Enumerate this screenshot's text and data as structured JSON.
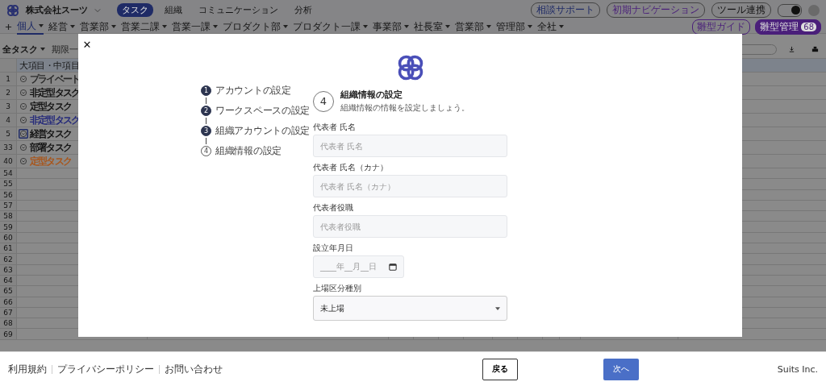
{
  "header": {
    "company": "株式会社スーツ",
    "nav": [
      {
        "label": "タスク",
        "selected": true
      },
      {
        "label": "組織",
        "selected": false
      },
      {
        "label": "コミュニケーション",
        "selected": false
      },
      {
        "label": "分析",
        "selected": false
      }
    ],
    "actions": [
      {
        "label": "相談サポート",
        "kind": "blue"
      },
      {
        "label": "初期ナビゲーション",
        "kind": "purple"
      },
      {
        "label": "ツール連携",
        "kind": "plain"
      }
    ],
    "toggle": {
      "on": true
    }
  },
  "board_tabs": [
    {
      "label": "個人",
      "selected": true
    },
    {
      "label": "経営",
      "selected": false
    },
    {
      "label": "営業部",
      "selected": false
    },
    {
      "label": "営業二課",
      "selected": false
    },
    {
      "label": "営業一課",
      "selected": false
    },
    {
      "label": "プロダクト部",
      "selected": false
    },
    {
      "label": "プロダクト一課",
      "selected": false
    },
    {
      "label": "事業部",
      "selected": false
    },
    {
      "label": "社長室",
      "selected": false
    },
    {
      "label": "営業部",
      "selected": false
    },
    {
      "label": "管理部",
      "selected": false
    },
    {
      "label": "全社",
      "selected": false
    }
  ],
  "template_buttons": [
    {
      "label": "雛型ガイド"
    },
    {
      "label": "雛型管理",
      "badge": "68"
    }
  ],
  "toolbar": {
    "filter": "全タスク",
    "chip": "期限一"
  },
  "table": {
    "column": "大項目・中項目",
    "rows": [
      {
        "num": "1",
        "task": "プライベート",
        "color": "#2a2a2a",
        "selected": false
      },
      {
        "num": "2",
        "task": "非定型タスク",
        "color": "#141414",
        "selected": false
      },
      {
        "num": "3",
        "task": "定型タスク",
        "color": "#141414",
        "selected": false
      },
      {
        "num": "4",
        "task": "非定型タスク",
        "color": "#252a7a",
        "selected": false
      },
      {
        "num": "5",
        "task": "経営タスク",
        "color": "#141414",
        "selected": true
      },
      {
        "num": "33",
        "task": "部署タスク",
        "color": "#141414",
        "selected": false
      },
      {
        "num": "40",
        "task": "定型タスク",
        "color": "#a8561c",
        "selected": false
      },
      {
        "num": "54"
      },
      {
        "num": "55"
      },
      {
        "num": "56"
      },
      {
        "num": "57"
      },
      {
        "num": "58"
      },
      {
        "num": "59"
      },
      {
        "num": "60"
      },
      {
        "num": "61"
      },
      {
        "num": "62"
      },
      {
        "num": "63"
      },
      {
        "num": "64"
      },
      {
        "num": "65"
      },
      {
        "num": "66"
      },
      {
        "num": "67"
      },
      {
        "num": "68"
      },
      {
        "num": "69"
      }
    ]
  },
  "modal": {
    "close": "✕",
    "steps": [
      {
        "num": "1",
        "label": "アカウントの設定",
        "done": true
      },
      {
        "num": "2",
        "label": "ワークスペースの設定",
        "done": true
      },
      {
        "num": "3",
        "label": "組織アカウントの設定",
        "done": true
      },
      {
        "num": "4",
        "label": "組織情報の設定",
        "done": false
      }
    ],
    "step_num": "4",
    "title": "組織情報の設定",
    "subtitle": "組織情報の情報を設定しましょう。",
    "fields": [
      {
        "kind": "text",
        "label": "代表者 氏名",
        "placeholder": "代表者 氏名"
      },
      {
        "kind": "text",
        "label": "代表者 氏名（カナ）",
        "placeholder": "代表者 氏名（カナ）"
      },
      {
        "kind": "text",
        "label": "代表者役職",
        "placeholder": "代表者役職"
      },
      {
        "kind": "date",
        "label": "設立年月日",
        "placeholder": "____年__月__日"
      },
      {
        "kind": "select",
        "label": "上場区分種別",
        "value": "未上場"
      }
    ]
  },
  "footer": {
    "links": [
      "利用規約",
      "プライバシーポリシー",
      "お問い合わせ"
    ],
    "back": "戻る",
    "next": "次へ",
    "brand": "Suits Inc."
  }
}
